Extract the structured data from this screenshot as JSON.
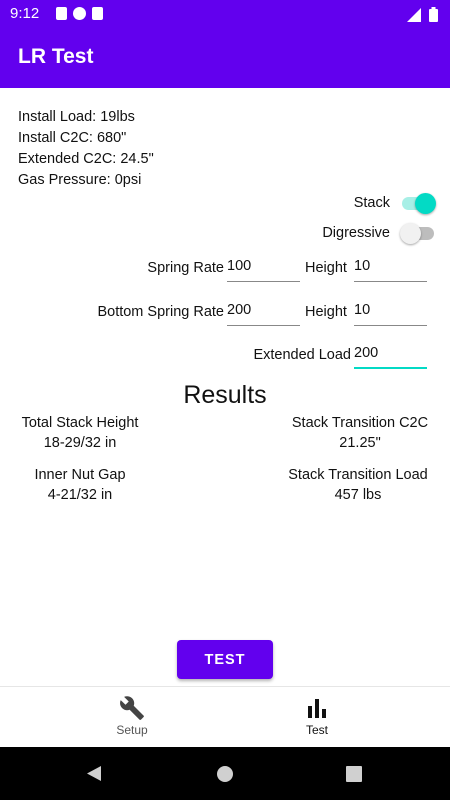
{
  "status_bar": {
    "time": "9:12"
  },
  "app_bar": {
    "title": "LR Test"
  },
  "info": {
    "install_load": "Install Load: 19lbs",
    "install_c2c": "Install C2C: 680\"",
    "extended_c2c": "Extended C2C: 24.5\"",
    "gas_pressure": "Gas Pressure: 0psi"
  },
  "toggles": {
    "stack": {
      "label": "Stack",
      "on": true
    },
    "digressive": {
      "label": "Digressive",
      "on": false
    }
  },
  "form": {
    "spring_rate_label": "Spring Rate",
    "spring_rate_value": "100",
    "height1_label": "Height",
    "height1_value": "10",
    "bottom_spring_rate_label": "Bottom Spring Rate",
    "bottom_spring_rate_value": "200",
    "height2_label": "Height",
    "height2_value": "10",
    "extended_load_label": "Extended Load",
    "extended_load_value": "200"
  },
  "results": {
    "title": "Results",
    "total_stack_height_label": "Total Stack Height",
    "total_stack_height_value": "18-29/32 in",
    "stack_transition_c2c_label": "Stack Transition C2C",
    "stack_transition_c2c_value": "21.25\"",
    "inner_nut_gap_label": "Inner Nut Gap",
    "inner_nut_gap_value": "4-21/32 in",
    "stack_transition_load_label": "Stack Transition Load",
    "stack_transition_load_value": "457 lbs"
  },
  "test_button": {
    "label": "TEST"
  },
  "bottom_nav": [
    {
      "label": "Setup",
      "icon": "wrench-icon",
      "active": false
    },
    {
      "label": "Test",
      "icon": "bar-chart-icon",
      "active": true
    }
  ],
  "colors": {
    "primary": "#6200ee",
    "accent": "#03dac5"
  }
}
